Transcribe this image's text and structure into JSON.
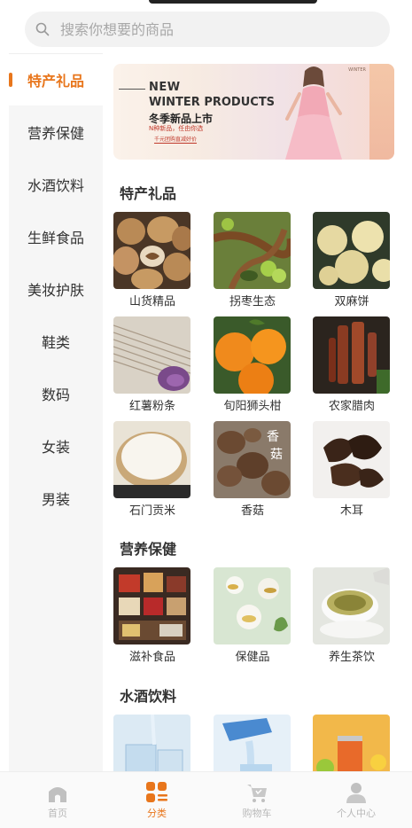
{
  "search": {
    "placeholder": "搜索你想要的商品"
  },
  "sidebar": {
    "items": [
      {
        "label": "特产礼品",
        "active": true
      },
      {
        "label": "营养保健",
        "active": false
      },
      {
        "label": "水酒饮料",
        "active": false
      },
      {
        "label": "生鲜食品",
        "active": false
      },
      {
        "label": "美妆护肤",
        "active": false
      },
      {
        "label": "鞋类",
        "active": false
      },
      {
        "label": "数码",
        "active": false
      },
      {
        "label": "女装",
        "active": false
      },
      {
        "label": "男装",
        "active": false
      }
    ]
  },
  "banner": {
    "line1": "NEW",
    "line2": "WINTER PRODUCTS",
    "line3": "冬季新品上市",
    "line4": "N种新品，任由你选",
    "tag": "千元团购直减好价",
    "corner": "WINTER"
  },
  "sections": [
    {
      "title": "特产礼品",
      "items": [
        {
          "label": "山货精品",
          "icon": "walnut-image"
        },
        {
          "label": "拐枣生态",
          "icon": "raisin-tree-image"
        },
        {
          "label": "双麻饼",
          "icon": "sesame-cake-image"
        },
        {
          "label": "红薯粉条",
          "icon": "sweet-potato-noodle-image"
        },
        {
          "label": "旬阳狮头柑",
          "icon": "orange-image"
        },
        {
          "label": "农家腊肉",
          "icon": "bacon-image"
        },
        {
          "label": "石门贡米",
          "icon": "rice-image"
        },
        {
          "label": "香菇",
          "icon": "mushroom-image"
        },
        {
          "label": "木耳",
          "icon": "fungus-image"
        }
      ]
    },
    {
      "title": "营养保健",
      "items": [
        {
          "label": "滋补食品",
          "icon": "tonic-herbs-image"
        },
        {
          "label": "保健品",
          "icon": "supplement-image"
        },
        {
          "label": "养生茶饮",
          "icon": "herbal-tea-image"
        }
      ]
    },
    {
      "title": "水酒饮料",
      "items": [
        {
          "label": "",
          "icon": "water-glass-image"
        },
        {
          "label": "",
          "icon": "bottled-water-image"
        },
        {
          "label": "",
          "icon": "soda-can-image"
        }
      ]
    }
  ],
  "tabbar": {
    "items": [
      {
        "label": "首页",
        "icon": "home-icon",
        "active": false
      },
      {
        "label": "分类",
        "icon": "category-icon",
        "active": true
      },
      {
        "label": "购物车",
        "icon": "cart-icon",
        "active": false
      },
      {
        "label": "个人中心",
        "icon": "user-icon",
        "active": false
      }
    ]
  },
  "colors": {
    "accent": "#e8761c",
    "inactive": "#b8b8b8",
    "sidebar_bg": "#f6f6f6"
  }
}
